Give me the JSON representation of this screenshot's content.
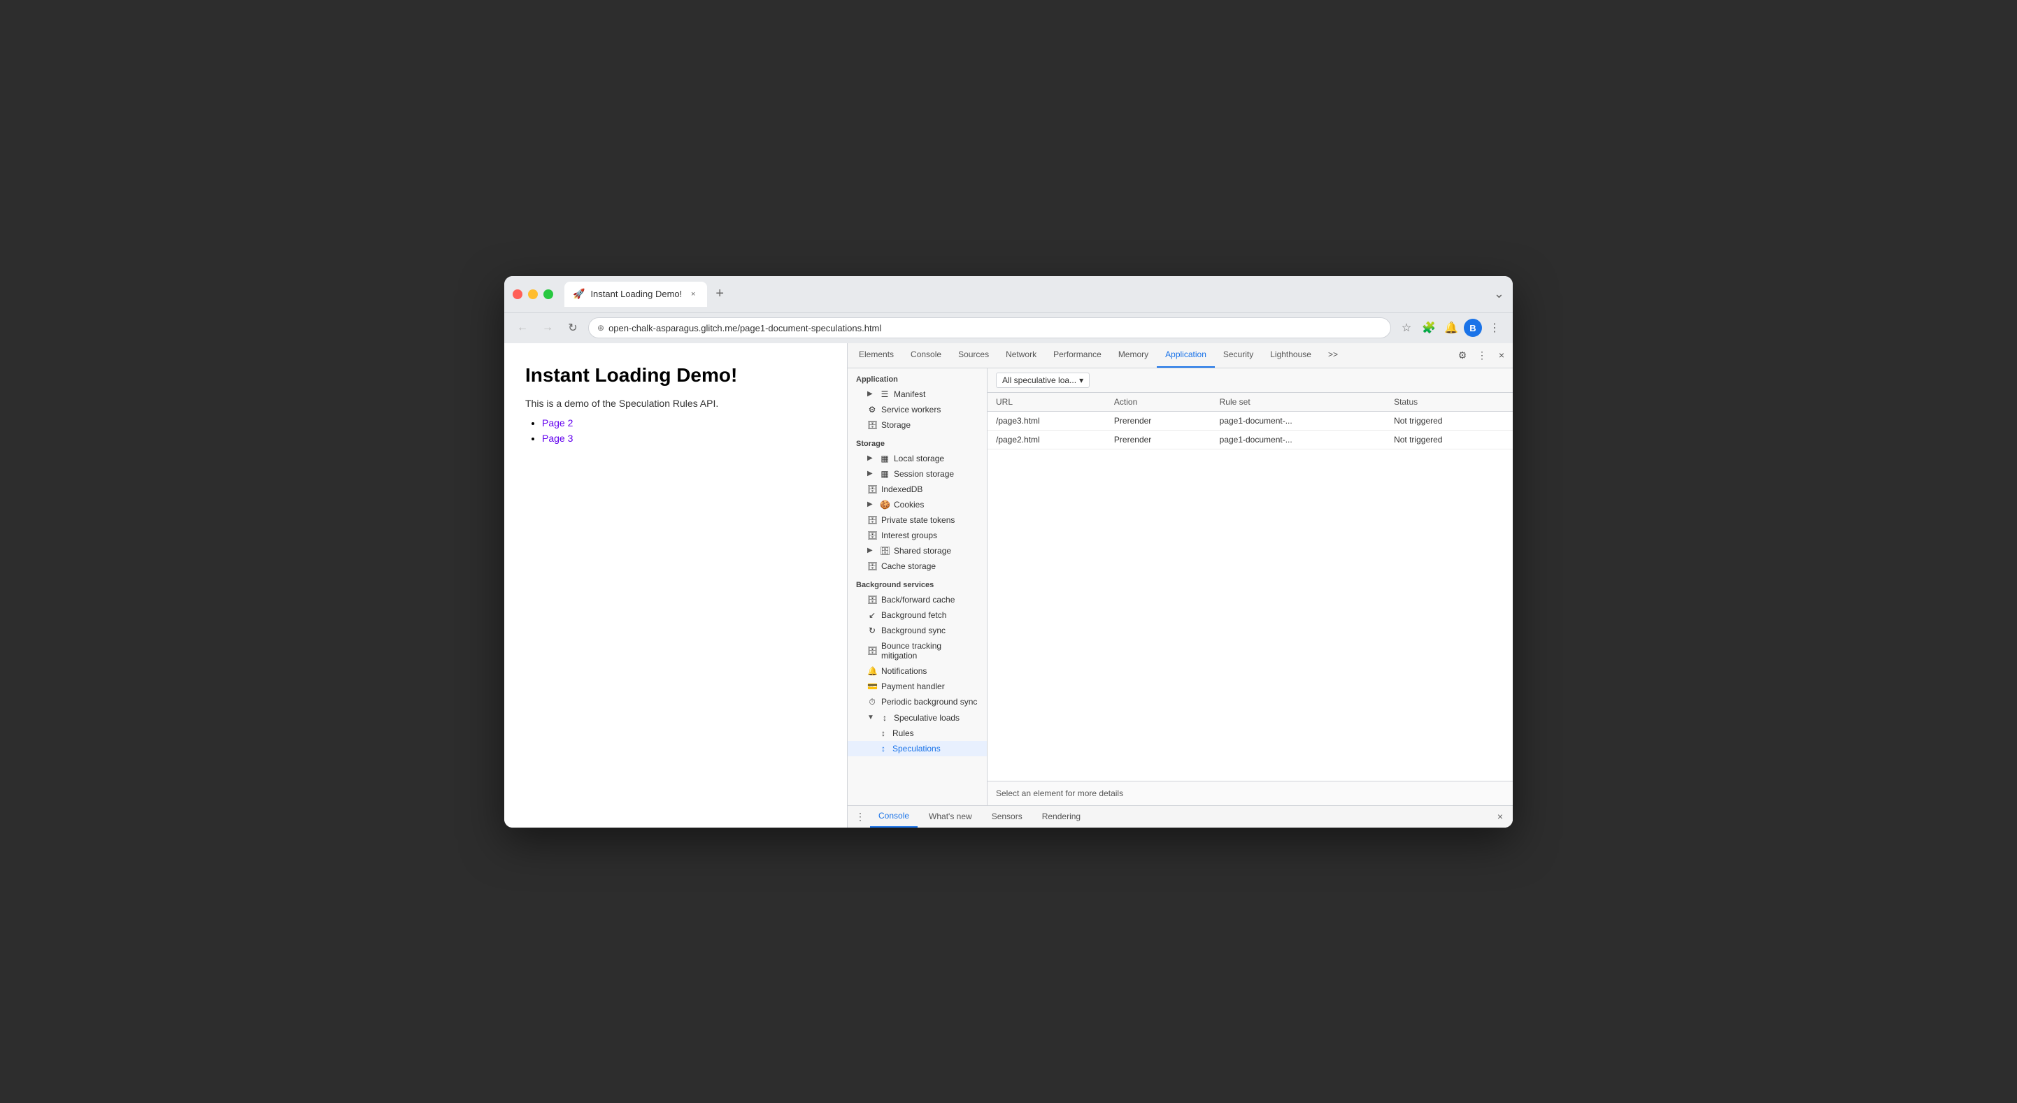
{
  "browser": {
    "tab_title": "Instant Loading Demo!",
    "tab_favicon": "🚀",
    "tab_close": "×",
    "tab_new": "+",
    "tab_expand": "⌄",
    "nav_back": "←",
    "nav_forward": "→",
    "nav_reload": "↻",
    "address_icon": "⊕",
    "address_url": "open-chalk-asparagus.glitch.me/page1-document-speculations.html",
    "toolbar_star": "☆",
    "toolbar_extensions": "🧩",
    "toolbar_profile": "🔔",
    "avatar_letter": "B",
    "toolbar_menu": "⋮"
  },
  "webpage": {
    "title": "Instant Loading Demo!",
    "description": "This is a demo of the Speculation Rules API.",
    "links": [
      {
        "text": "Page 2",
        "href": "#"
      },
      {
        "text": "Page 3",
        "href": "#"
      }
    ]
  },
  "devtools": {
    "tabs": [
      {
        "id": "elements",
        "label": "Elements"
      },
      {
        "id": "console",
        "label": "Console"
      },
      {
        "id": "sources",
        "label": "Sources"
      },
      {
        "id": "network",
        "label": "Network"
      },
      {
        "id": "performance",
        "label": "Performance"
      },
      {
        "id": "memory",
        "label": "Memory"
      },
      {
        "id": "application",
        "label": "Application",
        "active": true
      },
      {
        "id": "security",
        "label": "Security"
      },
      {
        "id": "lighthouse",
        "label": "Lighthouse"
      },
      {
        "id": "more",
        "label": ">>"
      }
    ],
    "settings_icon": "⚙",
    "more_icon": "⋮",
    "close_icon": "×",
    "sidebar": {
      "application_section": "Application",
      "application_items": [
        {
          "id": "manifest",
          "label": "Manifest",
          "icon": "☰",
          "indent": 1
        },
        {
          "id": "service-workers",
          "label": "Service workers",
          "icon": "⚙",
          "indent": 1
        },
        {
          "id": "storage",
          "label": "Storage",
          "icon": "🗄",
          "indent": 1
        }
      ],
      "storage_section": "Storage",
      "storage_items": [
        {
          "id": "local-storage",
          "label": "Local storage",
          "icon": "▦",
          "indent": 1,
          "expandable": true
        },
        {
          "id": "session-storage",
          "label": "Session storage",
          "icon": "▦",
          "indent": 1,
          "expandable": true
        },
        {
          "id": "indexeddb",
          "label": "IndexedDB",
          "icon": "🗄",
          "indent": 1
        },
        {
          "id": "cookies",
          "label": "Cookies",
          "icon": "🍪",
          "indent": 1,
          "expandable": true
        },
        {
          "id": "private-state",
          "label": "Private state tokens",
          "icon": "🗄",
          "indent": 1
        },
        {
          "id": "interest-groups",
          "label": "Interest groups",
          "icon": "🗄",
          "indent": 1
        },
        {
          "id": "shared-storage",
          "label": "Shared storage",
          "icon": "🗄",
          "indent": 1,
          "expandable": true
        },
        {
          "id": "cache-storage",
          "label": "Cache storage",
          "icon": "🗄",
          "indent": 1
        }
      ],
      "bg_section": "Background services",
      "bg_items": [
        {
          "id": "back-forward",
          "label": "Back/forward cache",
          "icon": "🗄",
          "indent": 1
        },
        {
          "id": "background-fetch",
          "label": "Background fetch",
          "icon": "↙",
          "indent": 1
        },
        {
          "id": "background-sync",
          "label": "Background sync",
          "icon": "↻",
          "indent": 1
        },
        {
          "id": "bounce-tracking",
          "label": "Bounce tracking mitigation",
          "icon": "🗄",
          "indent": 1
        },
        {
          "id": "notifications",
          "label": "Notifications",
          "icon": "🔔",
          "indent": 1
        },
        {
          "id": "payment-handler",
          "label": "Payment handler",
          "icon": "💳",
          "indent": 1
        },
        {
          "id": "periodic-sync",
          "label": "Periodic background sync",
          "icon": "⏱",
          "indent": 1
        },
        {
          "id": "speculative-loads",
          "label": "Speculative loads",
          "icon": "↕",
          "indent": 1,
          "expandable": true,
          "expanded": true
        },
        {
          "id": "rules",
          "label": "Rules",
          "icon": "↕",
          "indent": 2
        },
        {
          "id": "speculations",
          "label": "Speculations",
          "icon": "↕",
          "indent": 2,
          "active": true
        }
      ]
    },
    "panel": {
      "dropdown_label": "All speculative loa...",
      "dropdown_icon": "▾",
      "table": {
        "columns": [
          "URL",
          "Action",
          "Rule set",
          "Status"
        ],
        "rows": [
          {
            "url": "/page3.html",
            "action": "Prerender",
            "rule_set": "page1-document-...",
            "status": "Not triggered"
          },
          {
            "url": "/page2.html",
            "action": "Prerender",
            "rule_set": "page1-document-...",
            "status": "Not triggered"
          }
        ]
      },
      "footer_text": "Select an element for more details"
    }
  },
  "console_bar": {
    "menu_icon": "⋮",
    "tabs": [
      {
        "id": "console",
        "label": "Console",
        "active": true
      },
      {
        "id": "whats-new",
        "label": "What's new"
      },
      {
        "id": "sensors",
        "label": "Sensors"
      },
      {
        "id": "rendering",
        "label": "Rendering"
      }
    ],
    "close_icon": "×"
  }
}
